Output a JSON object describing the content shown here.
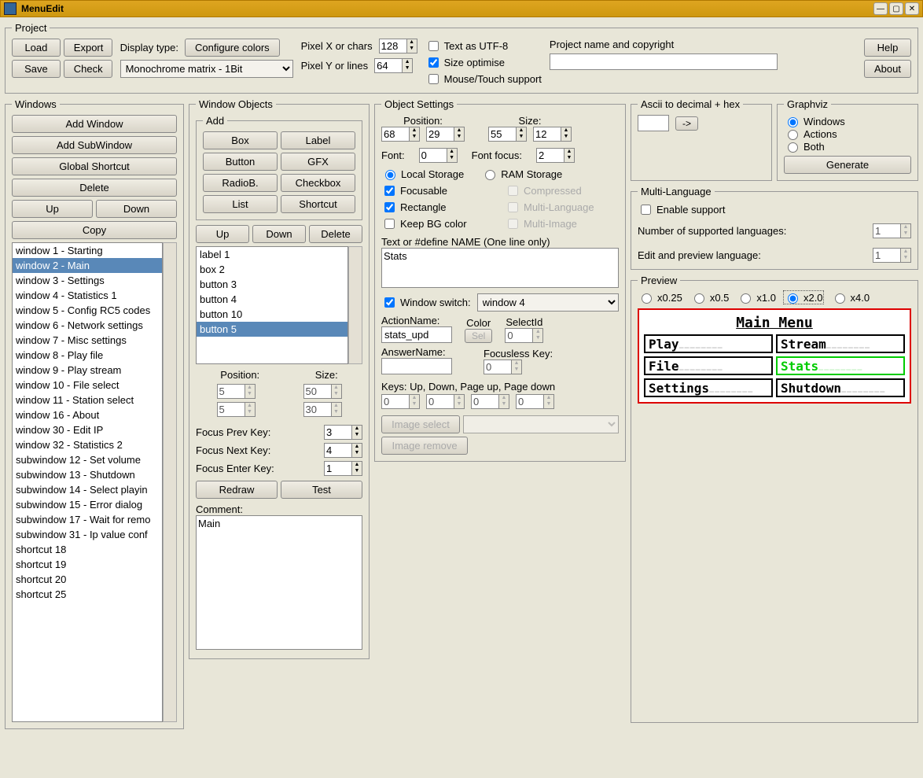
{
  "window_title": "MenuEdit",
  "project": {
    "legend": "Project",
    "load": "Load",
    "export": "Export",
    "save": "Save",
    "check": "Check",
    "display_type_lbl": "Display type:",
    "configure_colors": "Configure colors",
    "display_type_sel": "Monochrome matrix - 1Bit",
    "pixel_x_lbl": "Pixel X or chars",
    "pixel_x_val": "128",
    "pixel_y_lbl": "Pixel Y or lines",
    "pixel_y_val": "64",
    "text_utf8": "Text as UTF-8",
    "size_opt": "Size optimise",
    "mouse_touch": "Mouse/Touch support",
    "pname_lbl": "Project name and copyright",
    "pname_val": "",
    "help": "Help",
    "about": "About"
  },
  "windows_panel": {
    "legend": "Windows",
    "add_window": "Add Window",
    "add_subwindow": "Add SubWindow",
    "global_shortcut": "Global Shortcut",
    "delete": "Delete",
    "up": "Up",
    "down": "Down",
    "copy": "Copy",
    "items": [
      "window 1 - Starting",
      "window 2 - Main",
      "window 3 - Settings",
      "window 4 - Statistics 1",
      "window 5 - Config RC5 codes",
      "window 6 - Network settings",
      "window 7 - Misc settings",
      "window 8 - Play file",
      "window 9 - Play stream",
      "window 10 - File select",
      "window 11 - Station select",
      "window 16 - About",
      "window 30 - Edit IP",
      "window 32 - Statistics 2",
      "subwindow 12 - Set volume",
      "subwindow 13 - Shutdown",
      "subwindow 14 - Select playin",
      "subwindow 15 - Error dialog",
      "subwindow 17 - Wait for remo",
      "subwindow 31 - Ip value conf",
      "shortcut 18",
      "shortcut 19",
      "shortcut 20",
      "shortcut 25"
    ],
    "selected_index": 1
  },
  "wobjects": {
    "legend": "Window Objects",
    "add_legend": "Add",
    "box": "Box",
    "label": "Label",
    "button": "Button",
    "gfx": "GFX",
    "radiob": "RadioB.",
    "checkbox": "Checkbox",
    "list": "List",
    "shortcut": "Shortcut",
    "up": "Up",
    "down": "Down",
    "delete": "Delete",
    "items": [
      "label 1",
      "box 2",
      "button 3",
      "button 4",
      "button 10",
      "button 5"
    ],
    "selected_index": 5,
    "position_lbl": "Position:",
    "size_lbl": "Size:",
    "pos_x": "5",
    "pos_y": "5",
    "size_w": "50",
    "size_h": "30",
    "focus_prev_lbl": "Focus Prev Key:",
    "focus_prev": "3",
    "focus_next_lbl": "Focus Next Key:",
    "focus_next": "4",
    "focus_enter_lbl": "Focus Enter Key:",
    "focus_enter": "1",
    "redraw": "Redraw",
    "test": "Test",
    "comment_lbl": "Comment:",
    "comment_val": "Main"
  },
  "osettings": {
    "legend": "Object Settings",
    "position_lbl": "Position:",
    "size_lbl": "Size:",
    "pos_x": "68",
    "pos_y": "29",
    "size_w": "55",
    "size_h": "12",
    "font_lbl": "Font:",
    "font_val": "0",
    "font_focus_lbl": "Font focus:",
    "font_focus_val": "2",
    "local_storage": "Local Storage",
    "ram_storage": "RAM Storage",
    "focusable": "Focusable",
    "compressed": "Compressed",
    "rectangle": "Rectangle",
    "multi_lang": "Multi-Language",
    "keep_bg": "Keep BG color",
    "multi_image": "Multi-Image",
    "text_lbl": "Text or #define NAME (One line only)",
    "text_val": "Stats",
    "window_switch_lbl": "Window switch:",
    "window_switch_val": "window 4",
    "action_name_lbl": "ActionName:",
    "action_name_val": "stats_upd",
    "color_lbl": "Color",
    "color_btn": "Sel",
    "selectid_lbl": "SelectId",
    "selectid_val": "0",
    "answer_name_lbl": "AnswerName:",
    "answer_name_val": "",
    "focusless_key_lbl": "Focusless Key:",
    "focusless_key_val": "0",
    "keys_lbl": "Keys: Up, Down, Page up, Page down",
    "k1": "0",
    "k2": "0",
    "k3": "0",
    "k4": "0",
    "image_select": "Image select",
    "image_remove": "Image remove"
  },
  "ascii": {
    "legend": "Ascii to decimal + hex",
    "btn": "->"
  },
  "graphviz": {
    "legend": "Graphviz",
    "windows": "Windows",
    "actions": "Actions",
    "both": "Both",
    "generate": "Generate"
  },
  "multilang": {
    "legend": "Multi-Language",
    "enable": "Enable support",
    "num_lbl": "Number of supported languages:",
    "num_val": "1",
    "edit_lbl": "Edit and preview language:",
    "edit_val": "1"
  },
  "preview": {
    "legend": "Preview",
    "x025": "x0.25",
    "x05": "x0.5",
    "x10": "x1.0",
    "x20": "x2.0",
    "x40": "x4.0",
    "title": "Main Menu",
    "btns": [
      "Play",
      "Stream",
      "File",
      "Stats",
      "Settings",
      "Shutdown"
    ],
    "selected": 3
  }
}
